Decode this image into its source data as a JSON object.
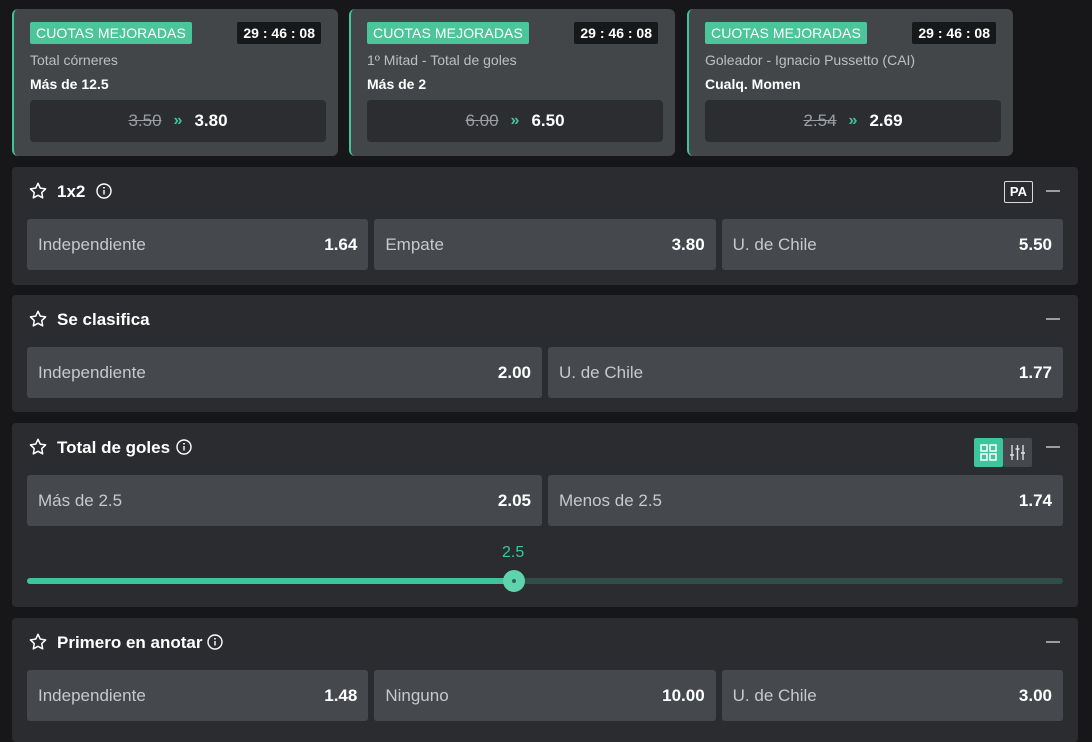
{
  "boosts": [
    {
      "badge": "CUOTAS MEJORADAS",
      "timer": "29 : 46 : 08",
      "market": "Total córneres",
      "selection": "Más de 12.5",
      "old_odd": "3.50",
      "new_odd": "3.80"
    },
    {
      "badge": "CUOTAS MEJORADAS",
      "timer": "29 : 46 : 08",
      "market": "1º Mitad - Total de goles",
      "selection": "Más de 2",
      "old_odd": "6.00",
      "new_odd": "6.50"
    },
    {
      "badge": "CUOTAS MEJORADAS",
      "timer": "29 : 46 : 08",
      "market": "Goleador - Ignacio Pussetto (CAI)",
      "selection": "Cualq. Momen",
      "old_odd": "2.54",
      "new_odd": "2.69"
    }
  ],
  "markets": {
    "m1x2": {
      "title": "1x2",
      "badge": "PA",
      "selections": [
        {
          "name": "Independiente",
          "odd": "1.64"
        },
        {
          "name": "Empate",
          "odd": "3.80"
        },
        {
          "name": "U. de Chile",
          "odd": "5.50"
        }
      ]
    },
    "clasifica": {
      "title": "Se clasifica",
      "selections": [
        {
          "name": "Independiente",
          "odd": "2.00"
        },
        {
          "name": "U. de Chile",
          "odd": "1.77"
        }
      ]
    },
    "goles": {
      "title": "Total de goles",
      "selections": [
        {
          "name": "Más de 2.5",
          "odd": "2.05"
        },
        {
          "name": "Menos de 2.5",
          "odd": "1.74"
        }
      ],
      "line_label": "2.5",
      "slider_fraction": 0.47
    },
    "primero": {
      "title": "Primero en anotar",
      "selections": [
        {
          "name": "Independiente",
          "odd": "1.48"
        },
        {
          "name": "Ninguno",
          "odd": "10.00"
        },
        {
          "name": "U. de Chile",
          "odd": "3.00"
        }
      ]
    }
  },
  "colors": {
    "accent": "#3ec59b",
    "panel": "#2b2c2f",
    "button": "#45484c",
    "background": "#171719"
  }
}
